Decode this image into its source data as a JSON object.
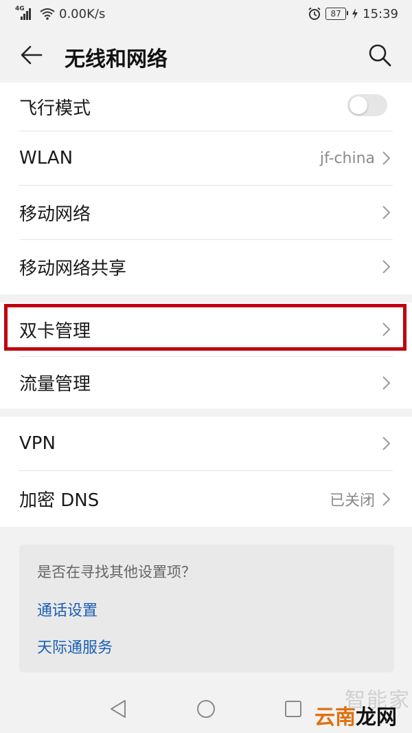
{
  "status_bar": {
    "network_type": "4G",
    "speed": "0.00K/s",
    "battery": "87",
    "time": "15:39"
  },
  "header": {
    "title": "无线和网络",
    "back_icon": "arrow-left-icon",
    "search_icon": "search-icon"
  },
  "items": {
    "airplane": {
      "label": "飞行模式",
      "toggle_on": false
    },
    "wlan": {
      "label": "WLAN",
      "value": "jf-china"
    },
    "mobile_network": {
      "label": "移动网络"
    },
    "tethering": {
      "label": "移动网络共享"
    },
    "dual_sim": {
      "label": "双卡管理"
    },
    "data_usage": {
      "label": "流量管理"
    },
    "vpn": {
      "label": "VPN"
    },
    "private_dns": {
      "label": "加密 DNS",
      "value": "已关闭"
    }
  },
  "suggestions": {
    "question": "是否在寻找其他设置项？",
    "links": [
      "通话设置",
      "天际通服务"
    ]
  },
  "colors": {
    "highlight": "#c00010",
    "link": "#1a5fb4",
    "background": "#f2f2f2"
  },
  "watermark": {
    "top": "智能家",
    "bottom_a": "云南",
    "bottom_b": "龙网"
  }
}
